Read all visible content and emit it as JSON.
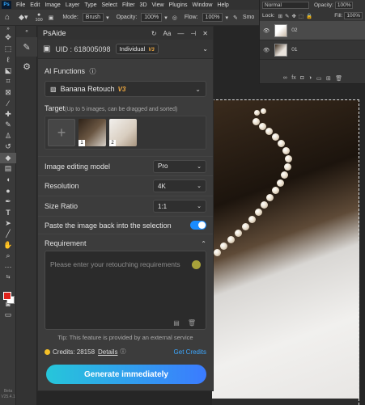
{
  "menubar": {
    "logo": "Ps",
    "items": [
      "File",
      "Edit",
      "Image",
      "Layer",
      "Type",
      "Select",
      "Filter",
      "3D",
      "View",
      "Plugins",
      "Window",
      "Help"
    ]
  },
  "options": {
    "brush_size": "100",
    "mode_label": "Mode:",
    "mode_value": "Brush",
    "opacity_label": "Opacity:",
    "opacity_value": "100%",
    "flow_label": "Flow:",
    "flow_value": "100%",
    "smoothing_label": "Smo"
  },
  "layers_panel": {
    "blend_mode": "Normal",
    "opacity_label": "Opacity:",
    "opacity_value": "100%",
    "lock_label": "Lock:",
    "fill_label": "Fill:",
    "fill_value": "100%",
    "layers": [
      {
        "name": "02",
        "active": true
      },
      {
        "name": "01",
        "active": false
      }
    ]
  },
  "plugin": {
    "title": "PsAide",
    "uid_label": "UID : 618005098",
    "plan": "Individual",
    "plan_version": "V3",
    "ai_functions_label": "AI Functions",
    "function_value": "Banana Retouch",
    "function_version": "V3",
    "target_label": "Target",
    "target_hint": "(Up to 5 images, can be dragged and sorted)",
    "target_images": [
      "1",
      "2"
    ],
    "model_label": "Image editing model",
    "model_value": "Pro",
    "resolution_label": "Resolution",
    "resolution_value": "4K",
    "size_label": "Size Ratio",
    "size_value": "1:1",
    "paste_label": "Paste the image back into the selection",
    "paste_enabled": true,
    "requirement_label": "Requirement",
    "requirement_placeholder": "Please enter your retouching requirements",
    "tip": "Tip: This feature is provided by an external service",
    "credits_label": "Credits: 28158",
    "details_label": "Details",
    "get_credits": "Get Credits",
    "generate_button": "Generate immediately"
  },
  "toolbar_footer": {
    "line1": "Beta",
    "line2": "V25.4.1"
  }
}
